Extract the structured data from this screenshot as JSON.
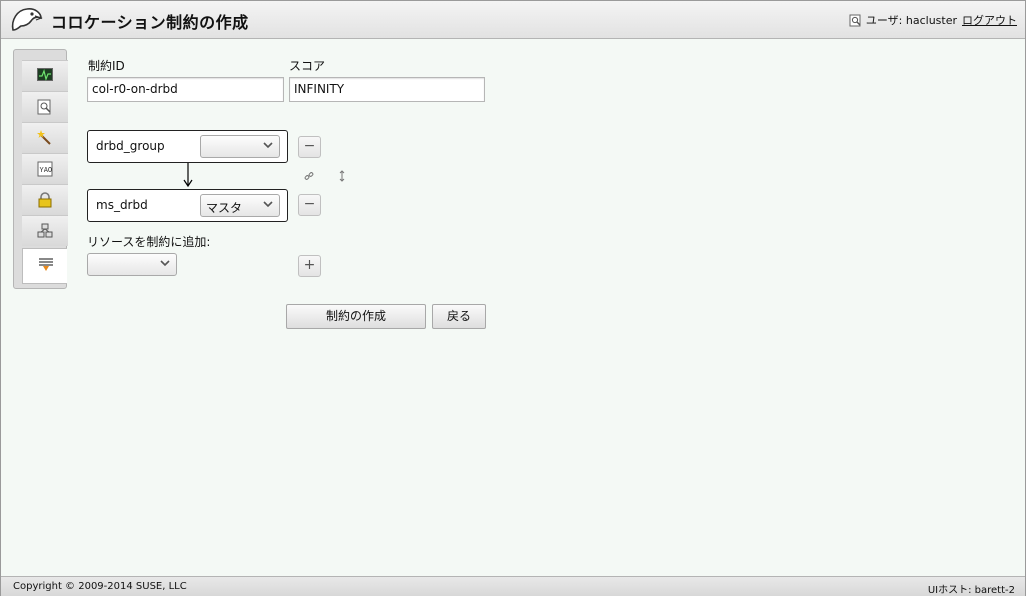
{
  "header": {
    "title": "コロケーション制約の作成",
    "user_label": "ユーザ: hacluster",
    "logout_label": "ログアウト"
  },
  "sidebar": {
    "items": [
      {
        "icon": "monitor-icon"
      },
      {
        "icon": "search-document-icon"
      },
      {
        "icon": "wand-icon"
      },
      {
        "icon": "config-icon"
      },
      {
        "icon": "lock-icon"
      },
      {
        "icon": "nodes-icon"
      },
      {
        "icon": "constraints-icon",
        "active": true
      }
    ]
  },
  "form": {
    "constraint_id_label": "制約ID",
    "constraint_id_value": "col-r0-on-drbd",
    "score_label": "スコア",
    "score_value": "INFINITY",
    "resources": [
      {
        "name": "drbd_group",
        "role": ""
      },
      {
        "name": "ms_drbd",
        "role": "マスタ"
      }
    ],
    "add_resource_label": "リソースを制約に追加:",
    "add_resource_value": "",
    "remove_symbol": "−",
    "add_symbol": "+",
    "create_button": "制約の作成",
    "back_button": "戻る"
  },
  "footer": {
    "copyright": "Copyright © 2009-2014 SUSE, LLC",
    "host": "UIホスト: barett-2"
  }
}
